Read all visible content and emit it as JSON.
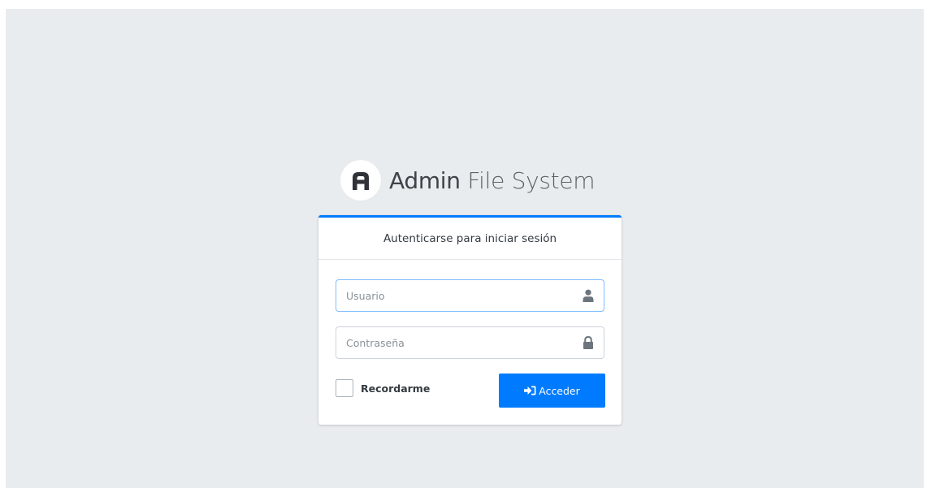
{
  "brand": {
    "name_bold": "Admin",
    "name_light": "File System",
    "logo_letter": "A"
  },
  "login": {
    "header": "Autenticarse para iniciar sesión",
    "username_placeholder": "Usuario",
    "username_value": "",
    "username_icon": "user-icon",
    "password_placeholder": "Contraseña",
    "password_value": "",
    "password_icon": "lock-icon",
    "remember_label": "Recordarme",
    "remember_checked": false,
    "submit_label": "Acceder",
    "submit_icon": "sign-in-icon"
  },
  "colors": {
    "accent": "#007bff",
    "background": "#e9ecef",
    "card": "#ffffff"
  }
}
